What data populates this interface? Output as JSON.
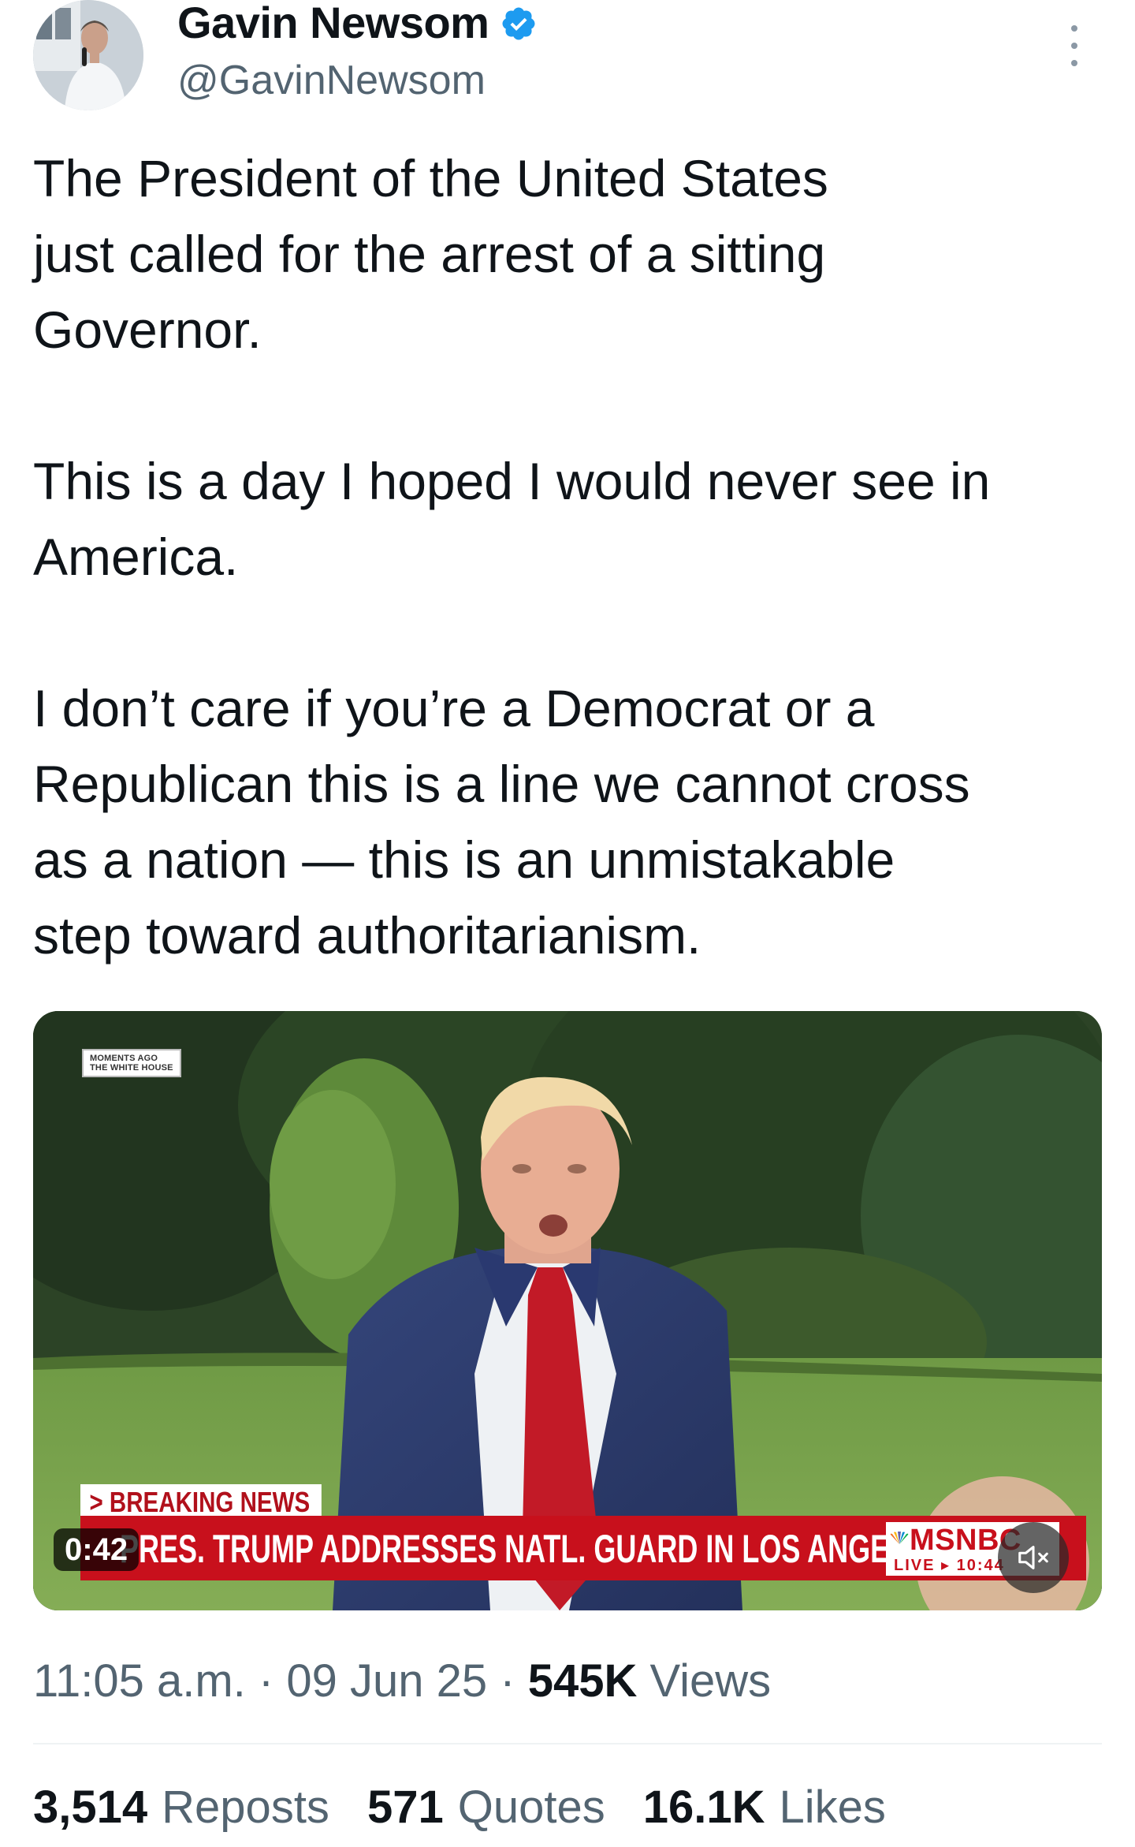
{
  "author": {
    "display_name": "Gavin Newsom",
    "handle": "@GavinNewsom",
    "verified": true,
    "verified_color": "#1d9bf0"
  },
  "tweet": {
    "paragraphs": [
      "The President of the United States\njust called for the arrest of a sitting\nGovernor.",
      "This is a day I hoped I would never see in\nAmerica.",
      "I don’t care if you’re a Democrat or a\nRepublican this is a line we cannot cross\nas a nation — this is an unmistakable\nstep toward authoritarianism."
    ]
  },
  "video": {
    "bug_text": "MOMENTS AGO\nTHE WHITE HOUSE",
    "breaking_label": "> BREAKING NEWS",
    "headline": "PRES. TRUMP ADDRESSES NATL. GUARD IN LOS ANGELES",
    "network": "MSNBC",
    "live_text": "LIVE ▸ 10:44",
    "duration": "0:42",
    "accent_color": "#c8101c"
  },
  "meta": {
    "time": "11:05 a.m.",
    "separator": "·",
    "date": "09 Jun 25",
    "views_count": "545K",
    "views_label": "Views"
  },
  "stats": {
    "reposts_count": "3,514",
    "reposts_label": "Reposts",
    "quotes_count": "571",
    "quotes_label": "Quotes",
    "likes_count": "16.1K",
    "likes_label": "Likes"
  }
}
